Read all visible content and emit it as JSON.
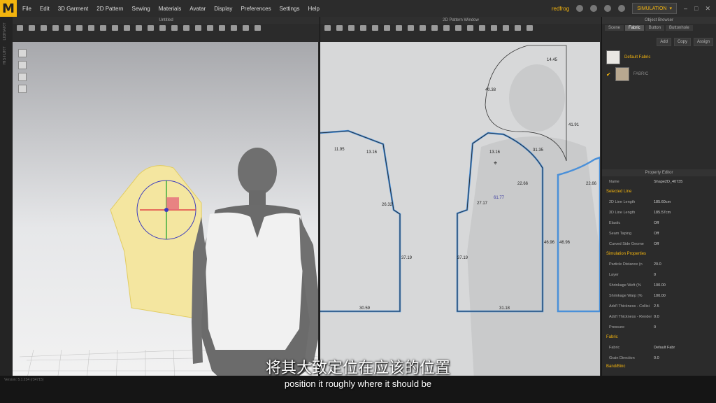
{
  "app": {
    "logo": "M",
    "menus": [
      "File",
      "Edit",
      "3D Garment",
      "2D Pattern",
      "Sewing",
      "Materials",
      "Avatar",
      "Display",
      "Preferences",
      "Settings",
      "Help"
    ],
    "user": "redfrog",
    "simulation": "SIMULATION"
  },
  "panels": {
    "untitled": "Untitled",
    "pattern_window": "2D Pattern Window"
  },
  "sidestrip": {
    "library": "LIBRARY",
    "history": "HISTORY"
  },
  "object_browser": {
    "title": "Object Browser",
    "tabs": [
      "Scene",
      "Fabric",
      "Button",
      "Buttonhole"
    ],
    "actions": [
      "Add",
      "Copy",
      "Assign"
    ],
    "fabrics": [
      "Default Fabric",
      "FABRIC"
    ]
  },
  "property_editor": {
    "title": "Property Editor",
    "name_label": "Name",
    "name_value": "Shape2D_40735",
    "selected_line": "Selected Line",
    "rows": [
      {
        "k": "2D Line Length",
        "v": "185.60cm"
      },
      {
        "k": "3D Line Length",
        "v": "185.57cm"
      },
      {
        "k": "Elastic",
        "v": "Off"
      },
      {
        "k": "Seam Taping",
        "v": "Off"
      },
      {
        "k": "Curved Side Geome",
        "v": "Off"
      }
    ],
    "sim_props": "Simulation Properties",
    "sim_rows": [
      {
        "k": "Particle Distance (n",
        "v": "20.0"
      },
      {
        "k": "Layer",
        "v": "0"
      },
      {
        "k": "Shrinkage Weft (%",
        "v": "100.00"
      },
      {
        "k": "Shrinkage Warp (%",
        "v": "100.00"
      },
      {
        "k": "Add'l Thickness - Collisi",
        "v": "2.5"
      },
      {
        "k": "Add'l Thickness - Render",
        "v": "0.0"
      },
      {
        "k": "Pressure",
        "v": "0"
      }
    ],
    "fabric_section": "Fabric",
    "fabric_label": "Fabric",
    "fabric_value": "Default Fabr",
    "grain_label": "Grain Direction",
    "grain_value": "0.0",
    "band": "Band/Binc"
  },
  "measurements": [
    "14.45",
    "40.38",
    "41.91",
    "13.16",
    "31.35",
    "11.95",
    "13.16",
    "22.66",
    "22.66",
    "26.32",
    "27.17",
    "61.77",
    "37.19",
    "37.19",
    "46.96",
    "46.96",
    "30.59",
    "31.18"
  ],
  "status": "Version: 5.1.234 (r34715)",
  "subtitles": {
    "cn": "将其大致定位在应该的位置",
    "en": "position it roughly where it should be"
  }
}
